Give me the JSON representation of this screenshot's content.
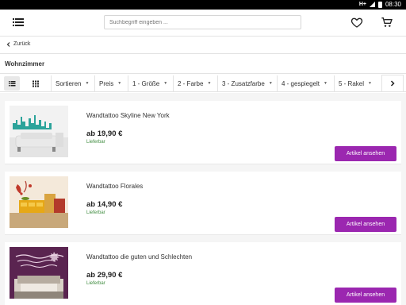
{
  "statusbar": {
    "signal": "H+",
    "time": "08:30"
  },
  "search": {
    "placeholder": "Suchbegriff eingeben ..."
  },
  "nav": {
    "back_label": "Zurück"
  },
  "category": {
    "title": "Wohnzimmer"
  },
  "filters": [
    {
      "label": "Sortieren"
    },
    {
      "label": "Preis"
    },
    {
      "label": "1 - Größe"
    },
    {
      "label": "2 - Farbe"
    },
    {
      "label": "3 - Zusatzfarbe"
    },
    {
      "label": "4 - gespiegelt"
    },
    {
      "label": "5 - Rakel"
    }
  ],
  "products": [
    {
      "name": "Wandtattoo Skyline New York",
      "price": "ab 19,90 €",
      "availability": "Lieferbar",
      "button": "Artikel ansehen"
    },
    {
      "name": "Wandtattoo Florales",
      "price": "ab 14,90 €",
      "availability": "Lieferbar",
      "button": "Artikel ansehen"
    },
    {
      "name": "Wandtattoo die guten und Schlechten",
      "price": "ab 29,90 €",
      "availability": "Lieferbar",
      "button": "Artikel ansehen"
    }
  ],
  "colors": {
    "accent": "#9b27b0",
    "availability": "#3c8a3c"
  },
  "icons": [
    "menu-icon",
    "heart-icon",
    "cart-icon",
    "chevron-left-icon",
    "list-view-icon",
    "grid-view-icon",
    "chevron-right-icon"
  ]
}
